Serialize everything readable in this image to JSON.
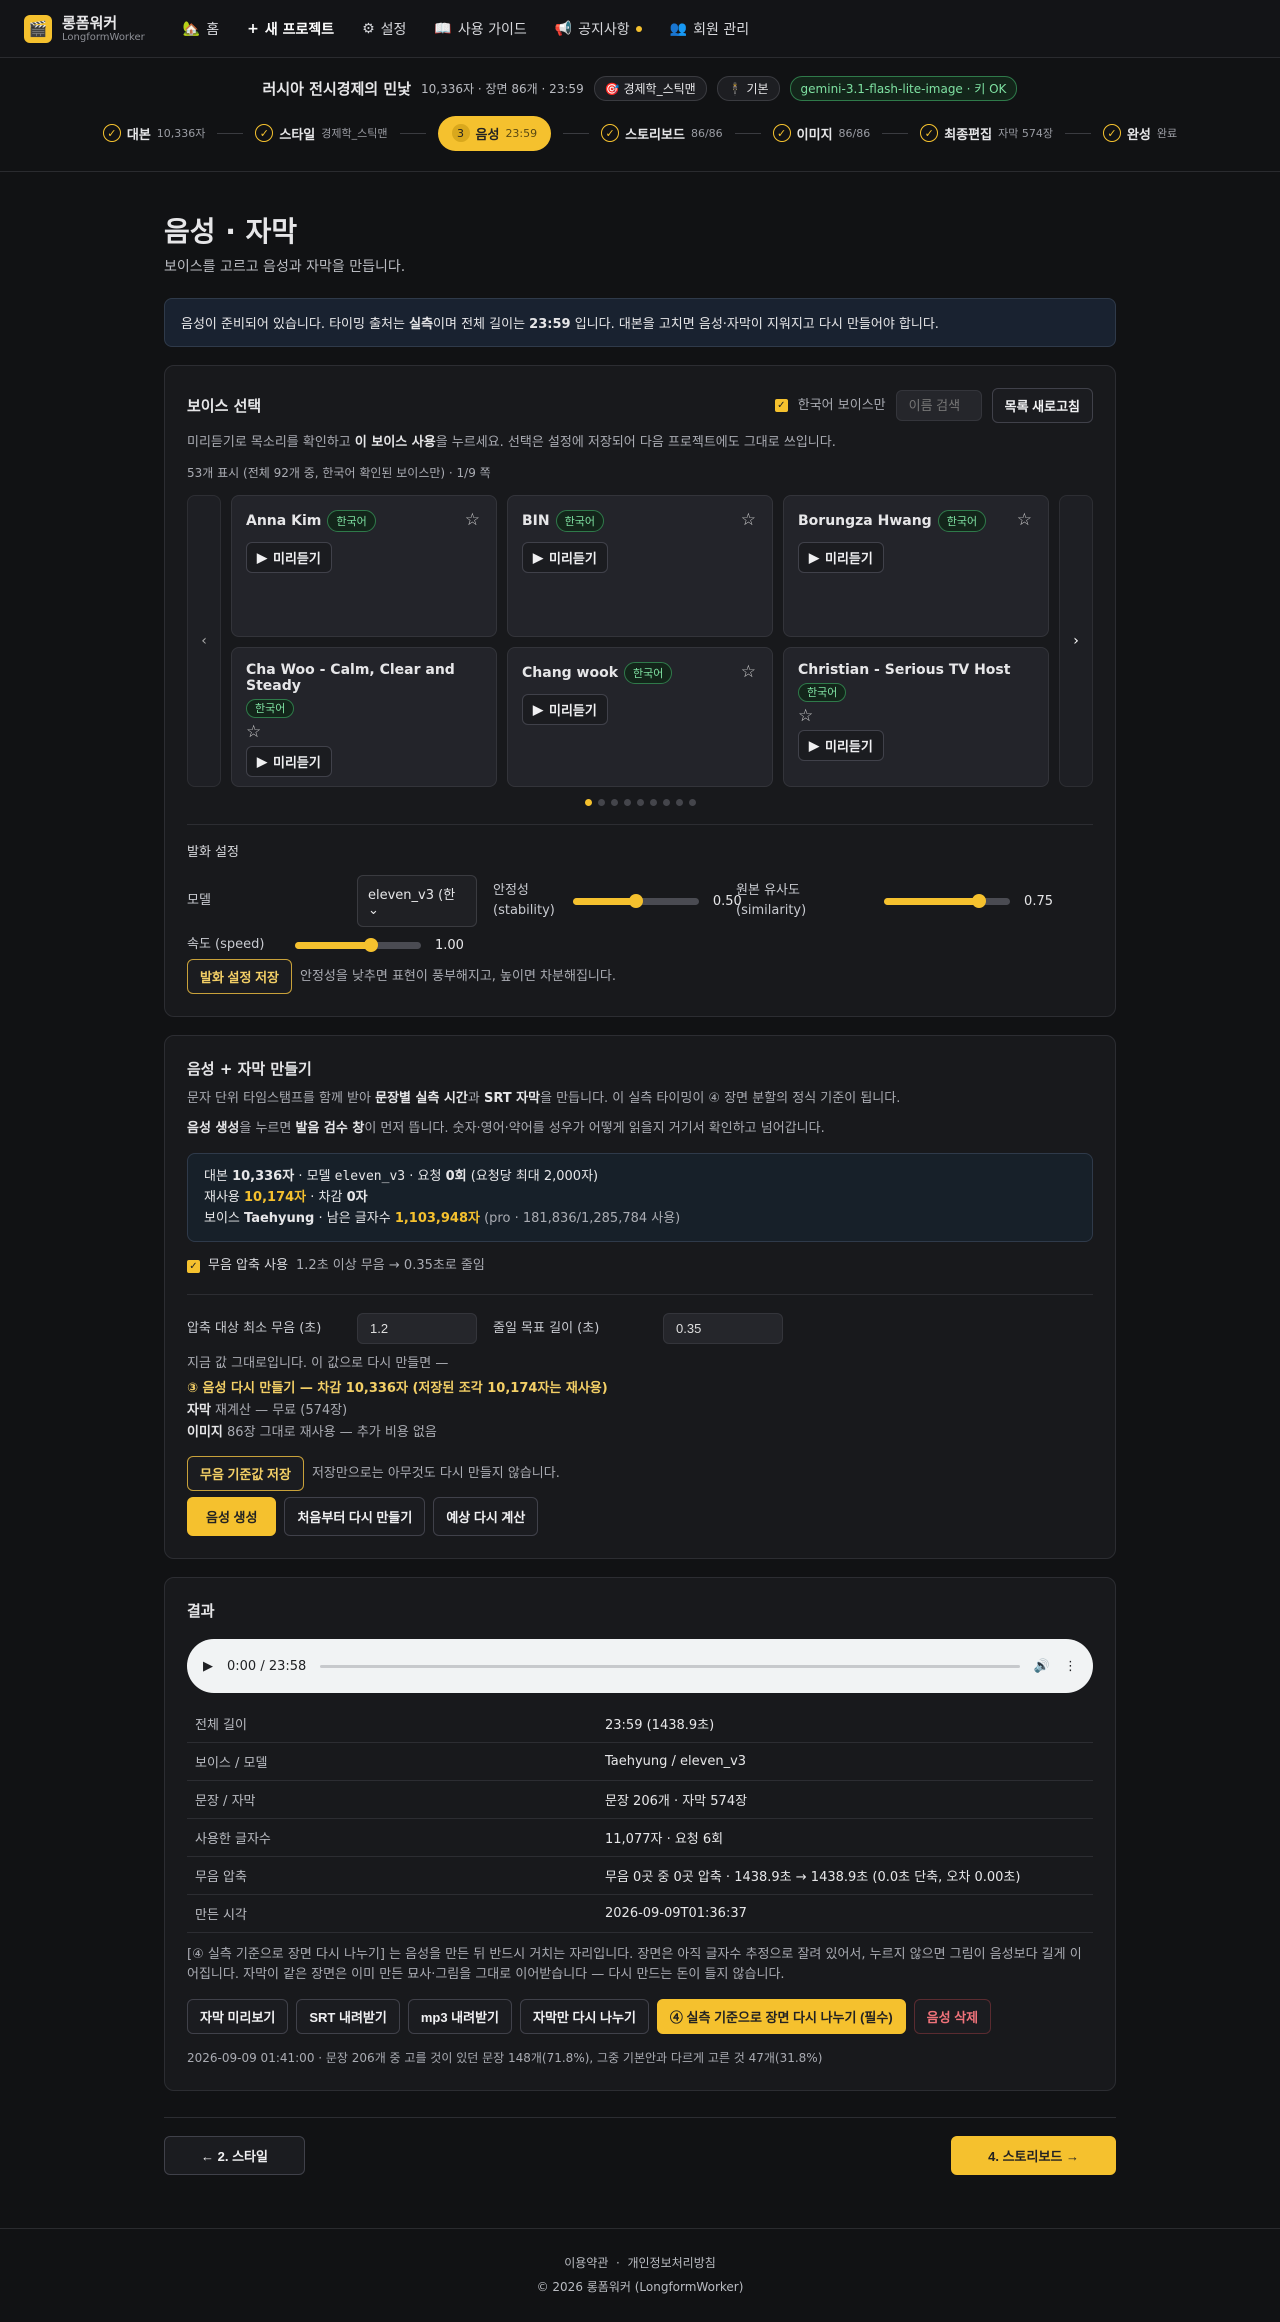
{
  "nav": {
    "brand": "롱폼워커",
    "brand_sub": "LongformWorker",
    "items": [
      {
        "icon": "🏡",
        "label": "홈"
      },
      {
        "icon": "+",
        "label": "새 프로젝트"
      },
      {
        "icon": "⚙",
        "label": "설정"
      },
      {
        "icon": "📖",
        "label": "사용 가이드"
      },
      {
        "icon": "📢",
        "label": "공지사항"
      },
      {
        "icon": "👥",
        "label": "회원 관리"
      }
    ]
  },
  "project": {
    "title": "러시아 전시경제의 민낯",
    "meta": "10,336자 · 장면 86개 · 23:59",
    "chip1": "🎯 경제학_스틱맨",
    "chip2": "🕴 기본",
    "chip3": "gemini-3.1-flash-lite-image · 키 OK"
  },
  "steps": [
    {
      "label": "대본",
      "sub": "10,336자"
    },
    {
      "label": "스타일",
      "sub": "경제학_스틱맨"
    },
    {
      "num": "3",
      "label": "음성",
      "sub": "23:59"
    },
    {
      "label": "스토리보드",
      "sub": "86/86"
    },
    {
      "label": "이미지",
      "sub": "86/86"
    },
    {
      "label": "최종편집",
      "sub": "자막 574장"
    },
    {
      "label": "완성",
      "sub": "완료"
    }
  ],
  "page": {
    "title": "음성 · 자막",
    "lead": "보이스를 고르고 음성과 자막을 만듭니다.",
    "notice_a": "음성이 준비되어 있습니다. 타이밍 출처는 ",
    "notice_b": "실측",
    "notice_c": "이며 전체 길이는 ",
    "notice_d": "23:59",
    "notice_e": " 입니다. 대본을 고치면 음성·자막이 지워지고 다시 만들어야 합니다."
  },
  "voice": {
    "title": "보이스 선택",
    "korean_only": "한국어 보이스만",
    "search_placeholder": "이름 검색",
    "refresh": "목록 새로고침",
    "desc_a": "미리듣기로 목소리를 확인하고 ",
    "desc_b": "이 보이스 사용",
    "desc_c": "을 누르세요. 선택은 설정에 저장되어 다음 프로젝트에도 그대로 쓰입니다.",
    "count": "53개 표시 (전체 92개 중, 한국어 확인된 보이스만) · 1/9 쪽",
    "preview": "미리듣기",
    "korean": "한국어",
    "cards": [
      "Anna Kim",
      "BIN",
      "Borungza Hwang",
      "Cha Woo - Calm, Clear and Steady",
      "Chang wook",
      "Christian - Serious TV Host"
    ]
  },
  "speech": {
    "title": "발화 설정",
    "model_label": "모델",
    "model_value": "eleven_v3 (한",
    "stability_label": "안정성 (stability)",
    "stability": 0.5,
    "stability_text": "0.50",
    "similarity_label": "원본 유사도 (similarity)",
    "similarity": 0.75,
    "similarity_text": "0.75",
    "speed_label": "속도 (speed)",
    "speed": 1.0,
    "speed_text": "1.00",
    "save": "발화 설정 저장",
    "hint": "안정성을 낮추면 표현이 풍부해지고, 높이면 차분해집니다."
  },
  "make": {
    "title": "음성 + 자막 만들기",
    "d1a": "문자 단위 타임스탬프를 함께 받아 ",
    "d1b": "문장별 실측 시간",
    "d1c": "과 ",
    "d1d": "SRT 자막",
    "d1e": "을 만듭니다. 이 실측 타이밍이 ④ 장면 분할의 정식 기준이 됩니다.",
    "d2a": "음성 생성",
    "d2b": "을 누르면 ",
    "d2c": "발음 검수 창",
    "d2d": "이 먼저 뜹니다. 숫자·영어·약어를 성우가 어떻게 읽을지 거기서 확인하고 넘어갑니다.",
    "i1a": "대본 ",
    "i1b": "10,336자",
    "i1c": " · 모델 ",
    "i1d": "eleven_v3",
    "i1e": " · 요청 ",
    "i1f": "0회",
    "i1g": " (요청당 최대 2,000자)",
    "i2a": "재사용 ",
    "i2b": "10,174자",
    "i2c": " · 차감 ",
    "i2d": "0자",
    "i3a": "보이스 ",
    "i3b": "Taehyung",
    "i3c": " · 남은 글자수 ",
    "i3d": "1,103,948자",
    "i3e": " (pro · 181,836/1,285,784 사용)",
    "silence_cb": "무음 압축 사용",
    "silence_hint": "1.2초 이상 무음 → 0.35초로 줄임",
    "min_label": "압축 대상 최소 무음 (초)",
    "min_value": "1.2",
    "target_label": "줄일 목표 길이 (초)",
    "target_value": "0.35",
    "current": "지금 값 그대로입니다. 이 값으로 다시 만들면 —",
    "r1": "③ 음성 다시 만들기 — 차감 10,336자 (저장된 조각 10,174자는 재사용)",
    "r2a": "자막",
    "r2b": " 재계산 — 무료 (574장)",
    "r3a": "이미지",
    "r3b": " 86장 그대로 재사용 — 추가 비용 없음",
    "save_silence": "무음 기준값 저장",
    "save_hint": "저장만으로는 아무것도 다시 만들지 않습니다.",
    "gen": "음성 생성",
    "regen": "처음부터 다시 만들기",
    "recalc": "예상 다시 계산"
  },
  "result": {
    "title": "결과",
    "time": "0:00 / 23:58",
    "rows": [
      [
        "전체 길이",
        "23:59 (1438.9초)"
      ],
      [
        "보이스 / 모델",
        "Taehyung / eleven_v3"
      ],
      [
        "문장 / 자막",
        "문장 206개 · 자막 574장"
      ],
      [
        "사용한 글자수",
        "11,077자 · 요청 6회"
      ],
      [
        "무음 압축",
        "무음 0곳 중 0곳 압축 · 1438.9초 → 1438.9초 (0.0초 단축, 오차 0.00초)"
      ],
      [
        "만든 시각",
        "2026-09-09T01:36:37"
      ]
    ],
    "note": "[④ 실측 기준으로 장면 다시 나누기] 는 음성을 만든 뒤 반드시 거치는 자리입니다. 장면은 아직 글자수 추정으로 잘려 있어서, 누르지 않으면 그림이 음성보다 길게 이어집니다. 자막이 같은 장면은 이미 만든 묘사·그림을 그대로 이어받습니다 — 다시 만드는 돈이 들지 않습니다.",
    "b1": "자막 미리보기",
    "b2": "SRT 내려받기",
    "b3": "mp3 내려받기",
    "b4": "자막만 다시 나누기",
    "b5": "④ 실측 기준으로 장면 다시 나누기 (필수)",
    "b6": "음성 삭제",
    "foot": "2026-09-09 01:41:00 · 문장 206개 중 고를 것이 있던 문장 148개(71.8%), 그중 기본안과 다르게 고른 것 47개(31.8%)"
  },
  "pager": {
    "prev": "← 2. 스타일",
    "next": "4. 스토리보드 →"
  },
  "footer": {
    "terms": "이용약관",
    "privacy": "개인정보처리방침",
    "copy": "© 2026 롱폼워커 (LongformWorker)"
  }
}
